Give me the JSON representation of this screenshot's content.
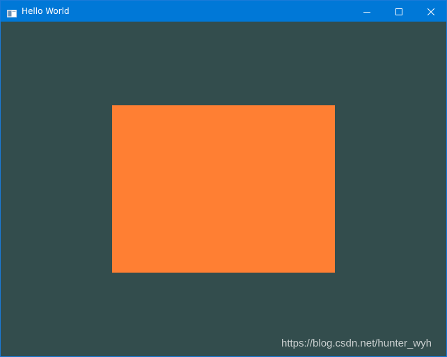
{
  "window": {
    "title": "Hello World",
    "title_bar_color": "#0078d7",
    "icons": {
      "app": "app-window-icon",
      "minimize": "minimize-icon",
      "maximize": "maximize-icon",
      "close": "close-icon"
    }
  },
  "canvas": {
    "clear_color": "#334d4d",
    "rectangle_color": "#ff7f33"
  },
  "watermark": {
    "text": "https://blog.csdn.net/hunter_wyh"
  }
}
